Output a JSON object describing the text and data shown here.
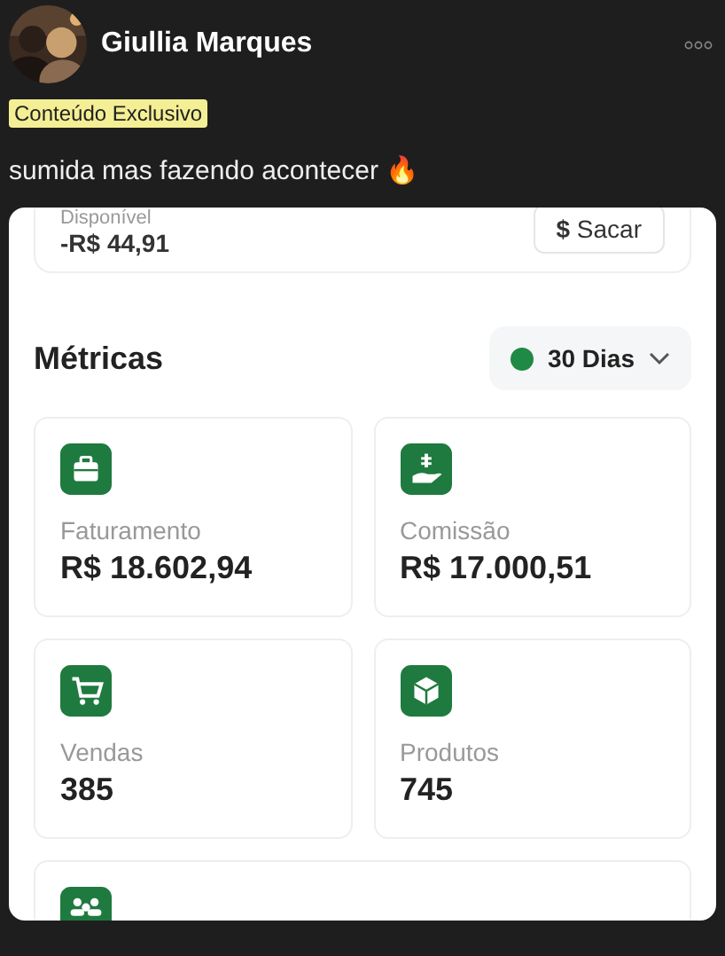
{
  "post": {
    "author": "Giullia Marques",
    "badge": "Conteúdo Exclusivo",
    "text": "sumida mas fazendo acontecer 🔥"
  },
  "screenshot": {
    "balance": {
      "label": "Disponível",
      "value": "-R$ 44,91",
      "button": {
        "symbol": "$",
        "label": "Sacar"
      }
    },
    "metrics": {
      "title": "Métricas",
      "period": "30 Dias",
      "cards": [
        {
          "kind": "briefcase",
          "label": "Faturamento",
          "value": "R$ 18.602,94"
        },
        {
          "kind": "hand",
          "label": "Comissão",
          "value": "R$ 17.000,51"
        },
        {
          "kind": "cart",
          "label": "Vendas",
          "value": "385"
        },
        {
          "kind": "box",
          "label": "Produtos",
          "value": "745"
        },
        {
          "kind": "people"
        }
      ]
    }
  }
}
